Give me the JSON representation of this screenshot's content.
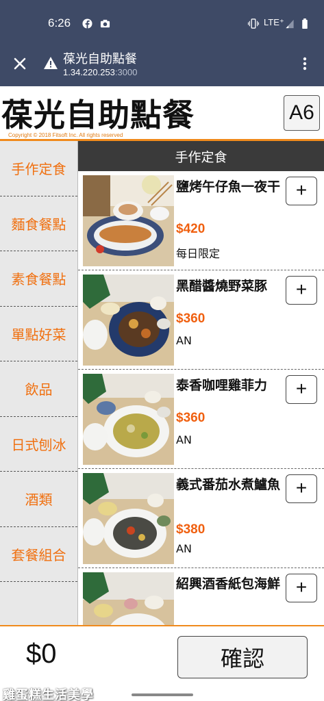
{
  "status_bar": {
    "time": "6:26",
    "network": "LTE⁺",
    "icons": [
      "facebook-icon",
      "camera-icon",
      "vibrate-icon",
      "signal-icon",
      "battery-icon"
    ]
  },
  "browser": {
    "title": "葆光自助點餐",
    "url_host": "1.34.220.253",
    "url_port": ":3000",
    "icons": [
      "close-icon",
      "warning-icon",
      "kebab-menu-icon"
    ]
  },
  "header": {
    "brand": "葆光自助點餐",
    "copyright": "Copyright © 2018 Fitsoft Inc. All rights reserved",
    "table_number": "A6"
  },
  "sidebar": {
    "categories": [
      {
        "label": "手作定食"
      },
      {
        "label": "麵食餐點"
      },
      {
        "label": "素食餐點"
      },
      {
        "label": "單點好菜"
      },
      {
        "label": "飲品"
      },
      {
        "label": "日式刨冰"
      },
      {
        "label": "酒類"
      },
      {
        "label": "套餐組合"
      }
    ]
  },
  "menu": {
    "section_title": "手作定食",
    "add_label": "+",
    "items": [
      {
        "name": "鹽烤午仔魚一夜干",
        "price": "$420",
        "note": "每日限定"
      },
      {
        "name": "黑醋醬燒野菜豚",
        "price": "$360",
        "note": "AN"
      },
      {
        "name": "泰香咖哩雞菲力",
        "price": "$360",
        "note": "AN"
      },
      {
        "name": "義式番茄水煮鱸魚",
        "price": "$380",
        "note": "AN"
      },
      {
        "name": "紹興酒香紙包海鮮",
        "price": "",
        "note": ""
      }
    ]
  },
  "footer": {
    "total": "$0",
    "confirm_label": "確認",
    "watermark": "雞蛋糕生活美學"
  },
  "colors": {
    "accent": "#f08a1c",
    "price": "#f06010",
    "chrome": "#3e4a66",
    "section_header": "#3a3a3a"
  }
}
